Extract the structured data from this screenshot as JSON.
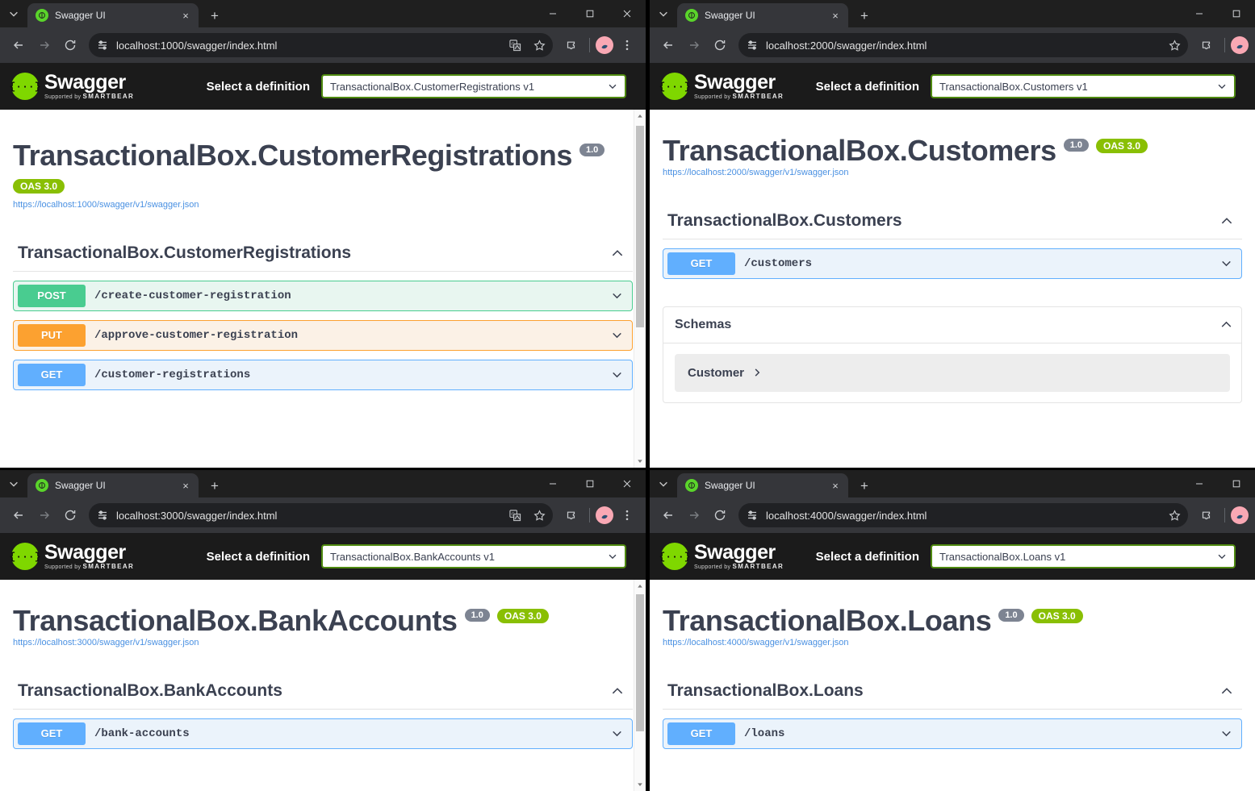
{
  "browser": {
    "tab_title": "Swagger UI",
    "new_tab_label": "+",
    "close_label": "×",
    "icons": {
      "tab_search": "tab-search-icon",
      "back": "back-arrow-icon",
      "forward": "forward-arrow-icon",
      "reload": "reload-icon",
      "site_info": "site-settings-icon",
      "translate": "translate-icon",
      "bookmark": "bookmark-star-icon",
      "extensions": "extensions-puzzle-icon",
      "profile": "profile-avatar-icon",
      "menu": "three-dot-menu-icon",
      "minimize": "minimize-icon",
      "maximize": "maximize-icon",
      "close": "close-icon"
    }
  },
  "swagger": {
    "logo_glyph": "{···}",
    "wordmark": "Swagger",
    "wordmark_dot": ".",
    "supported_by": "Supported by",
    "supported_by_brand": "SMARTBEAR",
    "select_label": "Select a definition"
  },
  "colors": {
    "oas_badge": "#89bf04",
    "version_badge": "#7d8492",
    "get": "#61affe",
    "post": "#49cc90",
    "put": "#fca130",
    "link": "#4990e2",
    "text": "#3b4151",
    "select_border": "#4f8a10",
    "topbar": "#1b1b1b"
  },
  "windows": [
    {
      "id": "customer-registrations",
      "url": "localhost:1000/swagger/index.html",
      "has_translate_icon": true,
      "has_close_button": true,
      "definition": "TransactionalBox.CustomerRegistrations v1",
      "api_title": "TransactionalBox.CustomerRegistrations",
      "version_badge": "1.0",
      "oas_badge": "OAS 3.0",
      "json_url": "https://localhost:1000/swagger/v1/swagger.json",
      "section_title": "TransactionalBox.CustomerRegistrations",
      "operations": [
        {
          "verb": "POST",
          "path": "/create-customer-registration"
        },
        {
          "verb": "PUT",
          "path": "/approve-customer-registration"
        },
        {
          "verb": "GET",
          "path": "/customer-registrations"
        }
      ],
      "schemas": null
    },
    {
      "id": "customers",
      "url": "localhost:2000/swagger/index.html",
      "has_translate_icon": false,
      "has_close_button": false,
      "definition": "TransactionalBox.Customers v1",
      "api_title": "TransactionalBox.Customers",
      "version_badge": "1.0",
      "oas_badge": "OAS 3.0",
      "json_url": "https://localhost:2000/swagger/v1/swagger.json",
      "section_title": "TransactionalBox.Customers",
      "operations": [
        {
          "verb": "GET",
          "path": "/customers"
        }
      ],
      "schemas": {
        "title": "Schemas",
        "items": [
          {
            "name": "Customer"
          }
        ]
      }
    },
    {
      "id": "bank-accounts",
      "url": "localhost:3000/swagger/index.html",
      "has_translate_icon": true,
      "has_close_button": true,
      "definition": "TransactionalBox.BankAccounts v1",
      "api_title": "TransactionalBox.BankAccounts",
      "version_badge": "1.0",
      "oas_badge": "OAS 3.0",
      "json_url": "https://localhost:3000/swagger/v1/swagger.json",
      "section_title": "TransactionalBox.BankAccounts",
      "operations": [
        {
          "verb": "GET",
          "path": "/bank-accounts"
        }
      ],
      "schemas": null
    },
    {
      "id": "loans",
      "url": "localhost:4000/swagger/index.html",
      "has_translate_icon": false,
      "has_close_button": false,
      "definition": "TransactionalBox.Loans v1",
      "api_title": "TransactionalBox.Loans",
      "version_badge": "1.0",
      "oas_badge": "OAS 3.0",
      "json_url": "https://localhost:4000/swagger/v1/swagger.json",
      "section_title": "TransactionalBox.Loans",
      "operations": [
        {
          "verb": "GET",
          "path": "/loans"
        }
      ],
      "schemas": null
    }
  ]
}
